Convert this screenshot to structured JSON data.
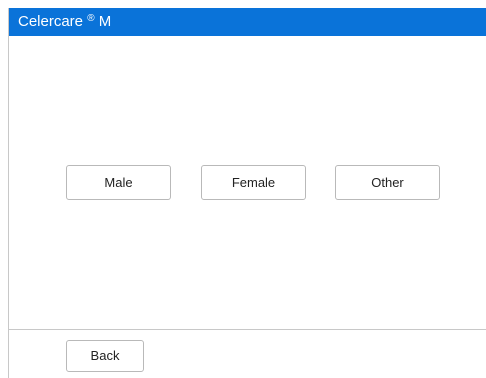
{
  "header": {
    "title_text": "Celercare",
    "title_mark": "®",
    "title_suffix": "M",
    "background_color": "#0a73d9"
  },
  "gender_options": [
    {
      "label": "Male"
    },
    {
      "label": "Female"
    },
    {
      "label": "Other"
    }
  ],
  "footer": {
    "back_label": "Back"
  }
}
